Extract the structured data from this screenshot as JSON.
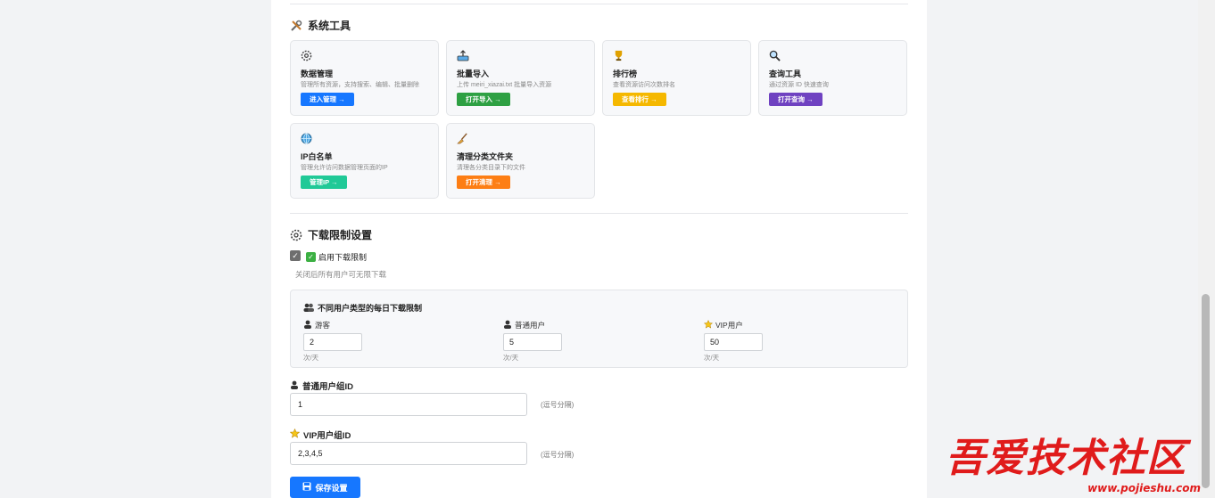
{
  "tools_section": {
    "title": "系统工具",
    "icon": "tools-icon",
    "cards": [
      {
        "icon": "gear-icon",
        "title": "数据管理",
        "desc": "管理所有资源，支持搜索、编辑、批量删除",
        "button": "进入管理 →",
        "color": "#1677ff"
      },
      {
        "icon": "inbox-upload-icon",
        "title": "批量导入",
        "desc": "上传 meiri_xiazai.txt 批量导入资源",
        "button": "打开导入 →",
        "color": "#2ea043"
      },
      {
        "icon": "trophy-icon",
        "title": "排行榜",
        "desc": "查看资源访问次数排名",
        "button": "查看排行 →",
        "color": "#f5b800"
      },
      {
        "icon": "magnifier-icon",
        "title": "查询工具",
        "desc": "通过资源 ID 快速查询",
        "button": "打开查询 →",
        "color": "#6f42c1"
      },
      {
        "icon": "globe-icon",
        "title": "IP白名单",
        "desc": "管理允许访问数据管理页面的IP",
        "button": "管理IP →",
        "color": "#20c997"
      },
      {
        "icon": "broom-icon",
        "title": "清理分类文件夹",
        "desc": "清理各分类目录下的文件",
        "button": "打开清理 →",
        "color": "#fd7e14"
      }
    ]
  },
  "download_section": {
    "title": "下载限制设置",
    "icon": "gear-icon",
    "enable_label": "启用下载限制",
    "enable_checked": true,
    "enable_hint": "关闭后所有用户可无限下载",
    "limits": {
      "title": "不同用户类型的每日下载限制",
      "columns": [
        {
          "label": "游客",
          "value": "2",
          "unit": "次/天",
          "icon": "user-icon"
        },
        {
          "label": "普通用户",
          "value": "5",
          "unit": "次/天",
          "icon": "user-icon"
        },
        {
          "label": "VIP用户",
          "value": "50",
          "unit": "次/天",
          "icon": "star-icon"
        }
      ]
    },
    "normal_group": {
      "label": "普通用户组ID",
      "value": "1",
      "hint": "(逗号分隔)"
    },
    "vip_group": {
      "label": "VIP用户组ID",
      "value": "2,3,4,5",
      "hint": "(逗号分隔)"
    },
    "save_label": "保存设置"
  },
  "watermark": {
    "text": "吾爱技术社区",
    "url": "www.pojieshu.com"
  }
}
